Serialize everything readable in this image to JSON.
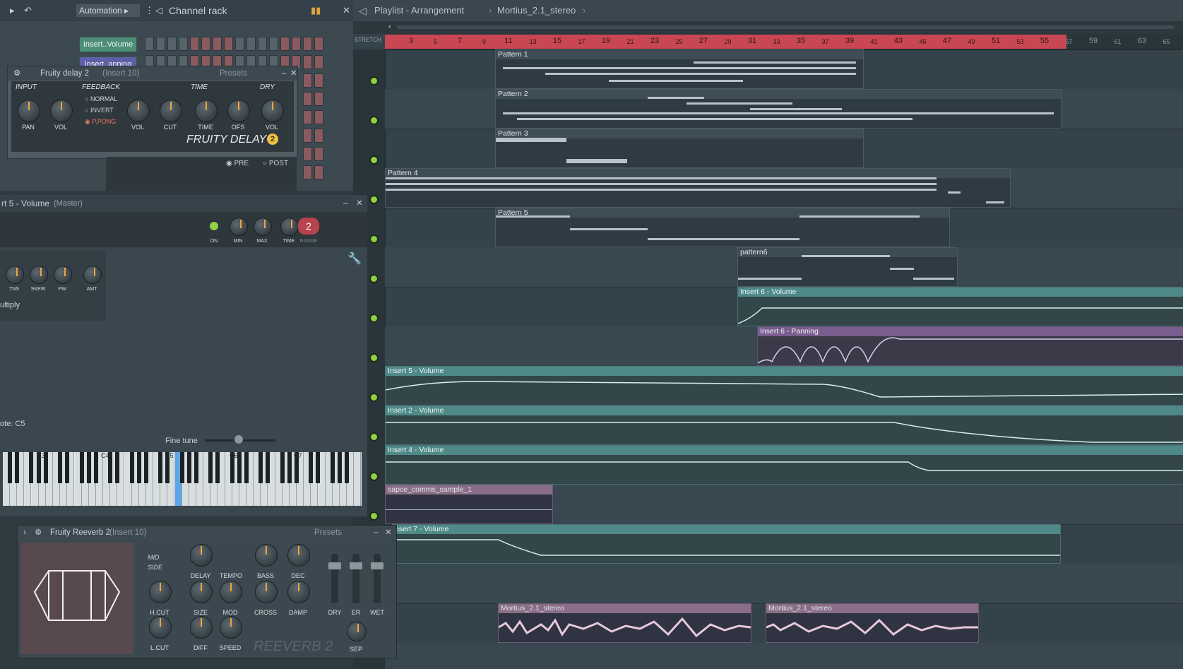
{
  "channel_rack": {
    "automation_label": "Automation",
    "title": "Channel rack",
    "channels": [
      "Insert..Volume",
      "Insert..anning"
    ]
  },
  "delay": {
    "title": "Fruity delay 2",
    "insert": "(Insert 10)",
    "presets": "Presets",
    "sections": {
      "input": "INPUT",
      "feedback": "FEEDBACK",
      "time": "TIME",
      "dry": "DRY"
    },
    "knobs": [
      "PAN",
      "VOL",
      "VOL",
      "CUT",
      "TIME",
      "OFS",
      "VOL"
    ],
    "modes": [
      "NORMAL",
      "INVERT",
      "P.PONG"
    ],
    "logo": "FRUITY DELAY",
    "pre": "PRE",
    "post": "POST"
  },
  "volume_window": {
    "title": "rt 5 - Volume",
    "subtitle": "(Master)",
    "knobs": [
      "ON",
      "MIN",
      "MAX",
      "TIME",
      "RANGE"
    ],
    "range_value": "2",
    "lfo_knobs": [
      "TNS",
      "SKEW",
      "PW",
      "AMT"
    ],
    "multiply": "ultiply",
    "note": "ote: C5",
    "fine_tune": "Fine tune",
    "octaves": [
      "C3",
      "C4",
      "C5",
      "C6",
      "C7"
    ]
  },
  "reverb": {
    "title": "Fruity Reeverb 2",
    "insert": "(Insert 10)",
    "presets": "Presets",
    "mid": "MID",
    "side": "SIDE",
    "knobs": [
      "DELAY",
      "TEMPO",
      "BASS",
      "DEC",
      "H.CUT",
      "SIZE",
      "MOD",
      "CROSS",
      "DAMP",
      "L.CUT",
      "DIFF",
      "SPEED"
    ],
    "sliders": [
      "DRY",
      "ER",
      "WET"
    ],
    "sep": "SEP",
    "logo": "REEVERB 2"
  },
  "playlist": {
    "title": "Playlist - Arrangement",
    "breadcrumb": "Mortius_2.1_stereo",
    "stretch": "STRETCH",
    "ruler": [
      "3",
      "5",
      "7",
      "9",
      "11",
      "13",
      "15",
      "17",
      "19",
      "21",
      "23",
      "25",
      "27",
      "29",
      "31",
      "33",
      "35",
      "37",
      "39",
      "41",
      "43",
      "45",
      "47",
      "49",
      "51",
      "53",
      "55",
      "57",
      "59",
      "61",
      "63",
      "65"
    ],
    "clips": [
      "Pattern 1",
      "Pattern 2",
      "Pattern 3",
      "Pattern 4",
      "Pattern 5",
      "pattern6",
      "Insert 6 - Volume",
      "Insert 6 - Panning",
      "Insert 5 - Volume",
      "Insert 2 - Volume",
      "Insert 4 - Volume",
      "sapce_comms_sample_1",
      "nsert 7 - Volume",
      "Mortius_2.1_stereo",
      "Mortius_2.1_stereo"
    ]
  }
}
